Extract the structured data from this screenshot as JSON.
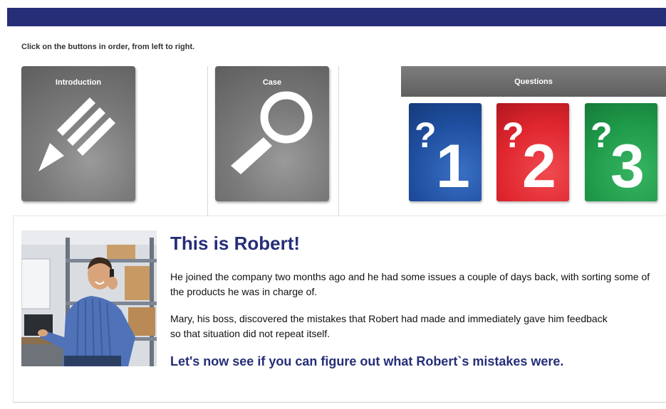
{
  "instruction": "Click on the buttons in order, from left to right.",
  "tiles": {
    "introduction": {
      "label": "Introduction",
      "icon": "pencil-icon"
    },
    "case": {
      "label": "Case",
      "icon": "magnifier-icon"
    }
  },
  "questions": {
    "header_label": "Questions",
    "cards": [
      {
        "number": "1",
        "symbol": "?",
        "color": "#1f4fa0"
      },
      {
        "number": "2",
        "symbol": "?",
        "color": "#e0262e"
      },
      {
        "number": "3",
        "symbol": "?",
        "color": "#1f9a4a"
      }
    ]
  },
  "content": {
    "title": "This is Robert!",
    "paragraph1": "He joined the company two months ago and he had some issues a couple of days back, with sorting some of the products he was in charge of.",
    "paragraph2": "Mary, his boss, discovered the mistakes that Robert had made and immediately gave him feedback so that situation did not repeat itself.",
    "cta": "Let's now see if you can figure out what Robert`s mistakes were."
  },
  "colors": {
    "brand": "#262e78"
  }
}
